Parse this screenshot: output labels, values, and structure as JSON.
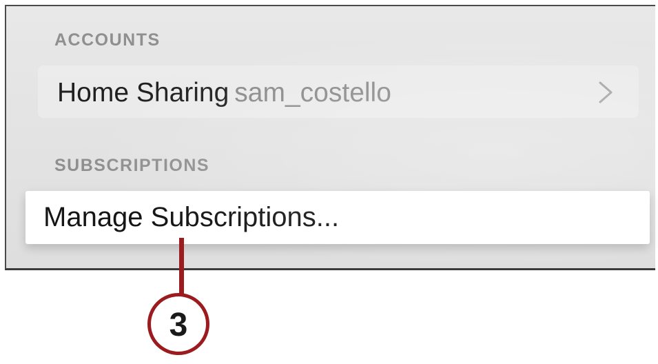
{
  "settings": {
    "accounts_header": "ACCOUNTS",
    "home_sharing": {
      "label": "Home Sharing",
      "value": "sam_costello",
      "chevron_icon": "chevron-right-icon"
    },
    "subscriptions_header": "SUBSCRIPTIONS",
    "manage_subscriptions": {
      "label": "Manage Subscriptions..."
    }
  },
  "callout": {
    "number": "3",
    "color": "#9b1b1f"
  }
}
